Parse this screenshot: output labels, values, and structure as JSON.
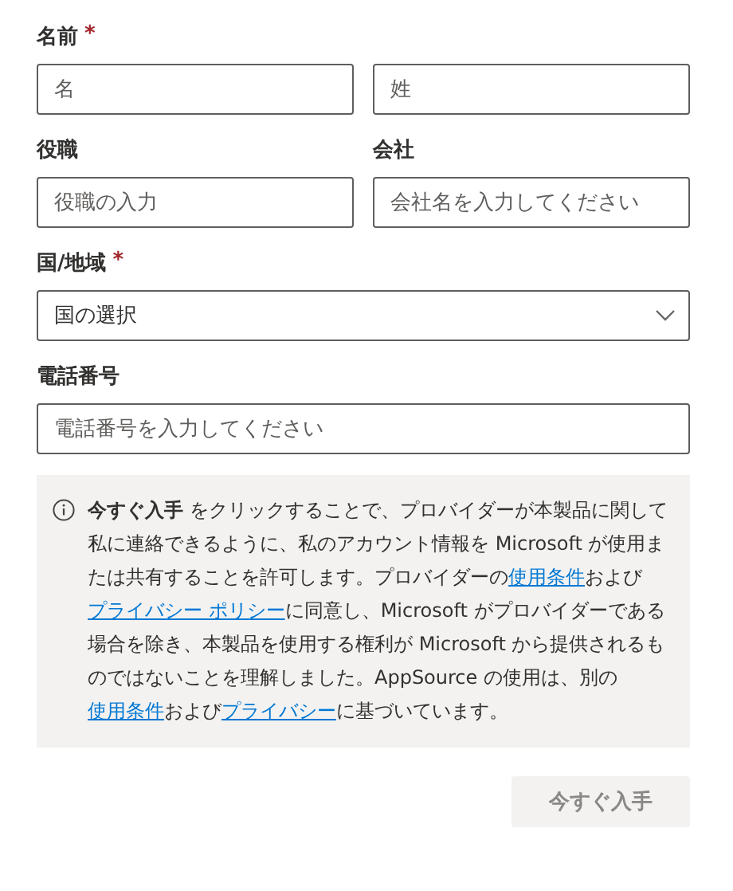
{
  "name": {
    "label": "名前",
    "mark": "*",
    "fields": [
      {
        "placeholder": "名"
      },
      {
        "placeholder": "姓"
      }
    ]
  },
  "row": [
    {
      "label": "役職",
      "placeholder": "役職の入力"
    },
    {
      "label": "会社",
      "placeholder": "会社名を入力してください"
    }
  ],
  "country": {
    "label": "国/地域",
    "mark": "*",
    "value": "国の選択"
  },
  "phone": {
    "label": "電話番号",
    "placeholder": "電話番号を入力してください"
  },
  "notice": [
    {
      "kind": "text",
      "text": "**今すぐ入手** をクリックすることで、プロバイダーが本製品に関して私に連絡できるように、私のアカウント情報を Microsoft が使用または共有することを許可します。プロバイダーの"
    },
    {
      "kind": "link",
      "text": "使用条件"
    },
    {
      "kind": "text",
      "text": "および"
    },
    {
      "kind": "link",
      "text": "プライバシー ポリシー"
    },
    {
      "kind": "text",
      "text": "に同意し、Microsoft がプロバイダーである場合を除き、本製品を使用する権利が Microsoft から提供されるものではないことを理解しました。AppSource の使用は、別の"
    },
    {
      "kind": "link",
      "text": "使用条件"
    },
    {
      "kind": "text",
      "text": "および"
    },
    {
      "kind": "link",
      "text": "プライバシー"
    },
    {
      "kind": "text",
      "text": "に基づいています。"
    }
  ],
  "submit": {
    "label": "今すぐ入手",
    "disabled": true
  }
}
